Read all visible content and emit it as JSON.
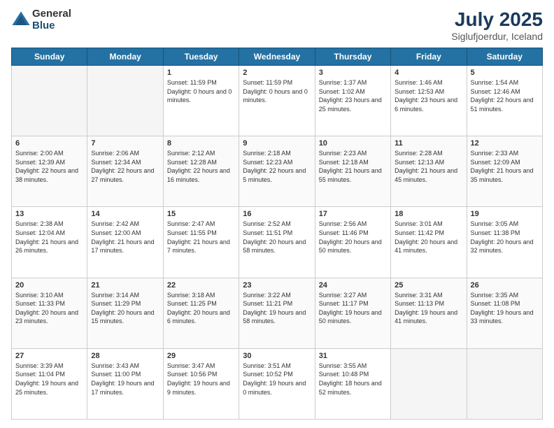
{
  "header": {
    "logo_general": "General",
    "logo_blue": "Blue",
    "month_title": "July 2025",
    "subtitle": "Siglufjoerdur, Iceland"
  },
  "days_of_week": [
    "Sunday",
    "Monday",
    "Tuesday",
    "Wednesday",
    "Thursday",
    "Friday",
    "Saturday"
  ],
  "weeks": [
    [
      {
        "day": "",
        "info": ""
      },
      {
        "day": "",
        "info": ""
      },
      {
        "day": "1",
        "info": "Sunset: 11:59 PM\nDaylight: 0 hours and 0 minutes."
      },
      {
        "day": "2",
        "info": "Sunset: 11:59 PM\nDaylight: 0 hours and 0 minutes."
      },
      {
        "day": "3",
        "info": "Sunrise: 1:37 AM\nSunset: 1:02 AM\nDaylight: 23 hours and 25 minutes."
      },
      {
        "day": "4",
        "info": "Sunrise: 1:46 AM\nSunset: 12:53 AM\nDaylight: 23 hours and 6 minutes."
      },
      {
        "day": "5",
        "info": "Sunrise: 1:54 AM\nSunset: 12:46 AM\nDaylight: 22 hours and 51 minutes."
      }
    ],
    [
      {
        "day": "6",
        "info": "Sunrise: 2:00 AM\nSunset: 12:39 AM\nDaylight: 22 hours and 38 minutes."
      },
      {
        "day": "7",
        "info": "Sunrise: 2:06 AM\nSunset: 12:34 AM\nDaylight: 22 hours and 27 minutes."
      },
      {
        "day": "8",
        "info": "Sunrise: 2:12 AM\nSunset: 12:28 AM\nDaylight: 22 hours and 16 minutes."
      },
      {
        "day": "9",
        "info": "Sunrise: 2:18 AM\nSunset: 12:23 AM\nDaylight: 22 hours and 5 minutes."
      },
      {
        "day": "10",
        "info": "Sunrise: 2:23 AM\nSunset: 12:18 AM\nDaylight: 21 hours and 55 minutes."
      },
      {
        "day": "11",
        "info": "Sunrise: 2:28 AM\nSunset: 12:13 AM\nDaylight: 21 hours and 45 minutes."
      },
      {
        "day": "12",
        "info": "Sunrise: 2:33 AM\nSunset: 12:09 AM\nDaylight: 21 hours and 35 minutes."
      }
    ],
    [
      {
        "day": "13",
        "info": "Sunrise: 2:38 AM\nSunset: 12:04 AM\nDaylight: 21 hours and 26 minutes."
      },
      {
        "day": "14",
        "info": "Sunrise: 2:42 AM\nSunset: 12:00 AM\nDaylight: 21 hours and 17 minutes."
      },
      {
        "day": "15",
        "info": "Sunrise: 2:47 AM\nSunset: 11:55 PM\nDaylight: 21 hours and 7 minutes."
      },
      {
        "day": "16",
        "info": "Sunrise: 2:52 AM\nSunset: 11:51 PM\nDaylight: 20 hours and 58 minutes."
      },
      {
        "day": "17",
        "info": "Sunrise: 2:56 AM\nSunset: 11:46 PM\nDaylight: 20 hours and 50 minutes."
      },
      {
        "day": "18",
        "info": "Sunrise: 3:01 AM\nSunset: 11:42 PM\nDaylight: 20 hours and 41 minutes."
      },
      {
        "day": "19",
        "info": "Sunrise: 3:05 AM\nSunset: 11:38 PM\nDaylight: 20 hours and 32 minutes."
      }
    ],
    [
      {
        "day": "20",
        "info": "Sunrise: 3:10 AM\nSunset: 11:33 PM\nDaylight: 20 hours and 23 minutes."
      },
      {
        "day": "21",
        "info": "Sunrise: 3:14 AM\nSunset: 11:29 PM\nDaylight: 20 hours and 15 minutes."
      },
      {
        "day": "22",
        "info": "Sunrise: 3:18 AM\nSunset: 11:25 PM\nDaylight: 20 hours and 6 minutes."
      },
      {
        "day": "23",
        "info": "Sunrise: 3:22 AM\nSunset: 11:21 PM\nDaylight: 19 hours and 58 minutes."
      },
      {
        "day": "24",
        "info": "Sunrise: 3:27 AM\nSunset: 11:17 PM\nDaylight: 19 hours and 50 minutes."
      },
      {
        "day": "25",
        "info": "Sunrise: 3:31 AM\nSunset: 11:13 PM\nDaylight: 19 hours and 41 minutes."
      },
      {
        "day": "26",
        "info": "Sunrise: 3:35 AM\nSunset: 11:08 PM\nDaylight: 19 hours and 33 minutes."
      }
    ],
    [
      {
        "day": "27",
        "info": "Sunrise: 3:39 AM\nSunset: 11:04 PM\nDaylight: 19 hours and 25 minutes."
      },
      {
        "day": "28",
        "info": "Sunrise: 3:43 AM\nSunset: 11:00 PM\nDaylight: 19 hours and 17 minutes."
      },
      {
        "day": "29",
        "info": "Sunrise: 3:47 AM\nSunset: 10:56 PM\nDaylight: 19 hours and 9 minutes."
      },
      {
        "day": "30",
        "info": "Sunrise: 3:51 AM\nSunset: 10:52 PM\nDaylight: 19 hours and 0 minutes."
      },
      {
        "day": "31",
        "info": "Sunrise: 3:55 AM\nSunset: 10:48 PM\nDaylight: 18 hours and 52 minutes."
      },
      {
        "day": "",
        "info": ""
      },
      {
        "day": "",
        "info": ""
      }
    ]
  ]
}
